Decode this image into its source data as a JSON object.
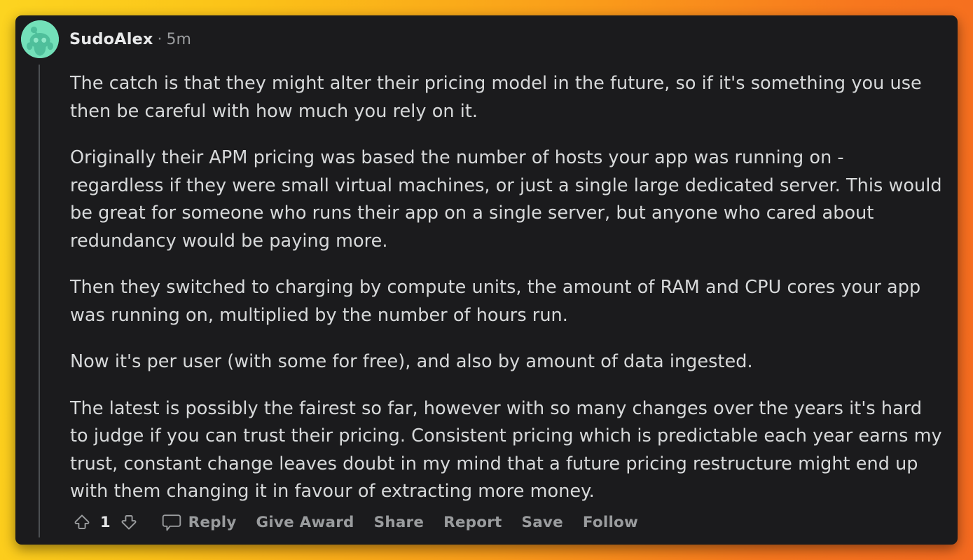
{
  "theme": {
    "page_gradient_start": "#fcd420",
    "page_gradient_end": "#f56a20",
    "card_background": "#1b1b1d",
    "body_text_color": "#d7d9da",
    "muted_text_color": "#9a9c9e",
    "avatar_background": "#73e0b9"
  },
  "comment": {
    "author": "SudoAlex",
    "separator": "·",
    "timestamp": "5m",
    "avatar_icon": "reddit-snoo-avatar",
    "paragraphs": [
      "The catch is that they might alter their pricing model in the future, so if it's something you use then be careful with how much you rely on it.",
      "Originally their APM pricing was based the number of hosts your app was running on - regardless if they were small virtual machines, or just a single large dedicated server. This would be great for someone who runs their app on a single server, but anyone who cared about redundancy would be paying more.",
      "Then they switched to charging by compute units, the amount of RAM and CPU cores your app was running on, multiplied by the number of hours run.",
      "Now it's per user (with some for free), and also by amount of data ingested.",
      "The latest is possibly the fairest so far, however with so many changes over the years it's hard to judge if you can trust their pricing. Consistent pricing which is predictable each year earns my trust, constant change leaves doubt in my mind that a future pricing restructure might end up with them changing it in favour of extracting more money."
    ]
  },
  "actions": {
    "upvote_icon": "upvote-arrow-icon",
    "vote_count": "1",
    "downvote_icon": "downvote-arrow-icon",
    "comment_icon": "comment-bubble-icon",
    "reply_label": "Reply",
    "give_award_label": "Give Award",
    "share_label": "Share",
    "report_label": "Report",
    "save_label": "Save",
    "follow_label": "Follow"
  }
}
